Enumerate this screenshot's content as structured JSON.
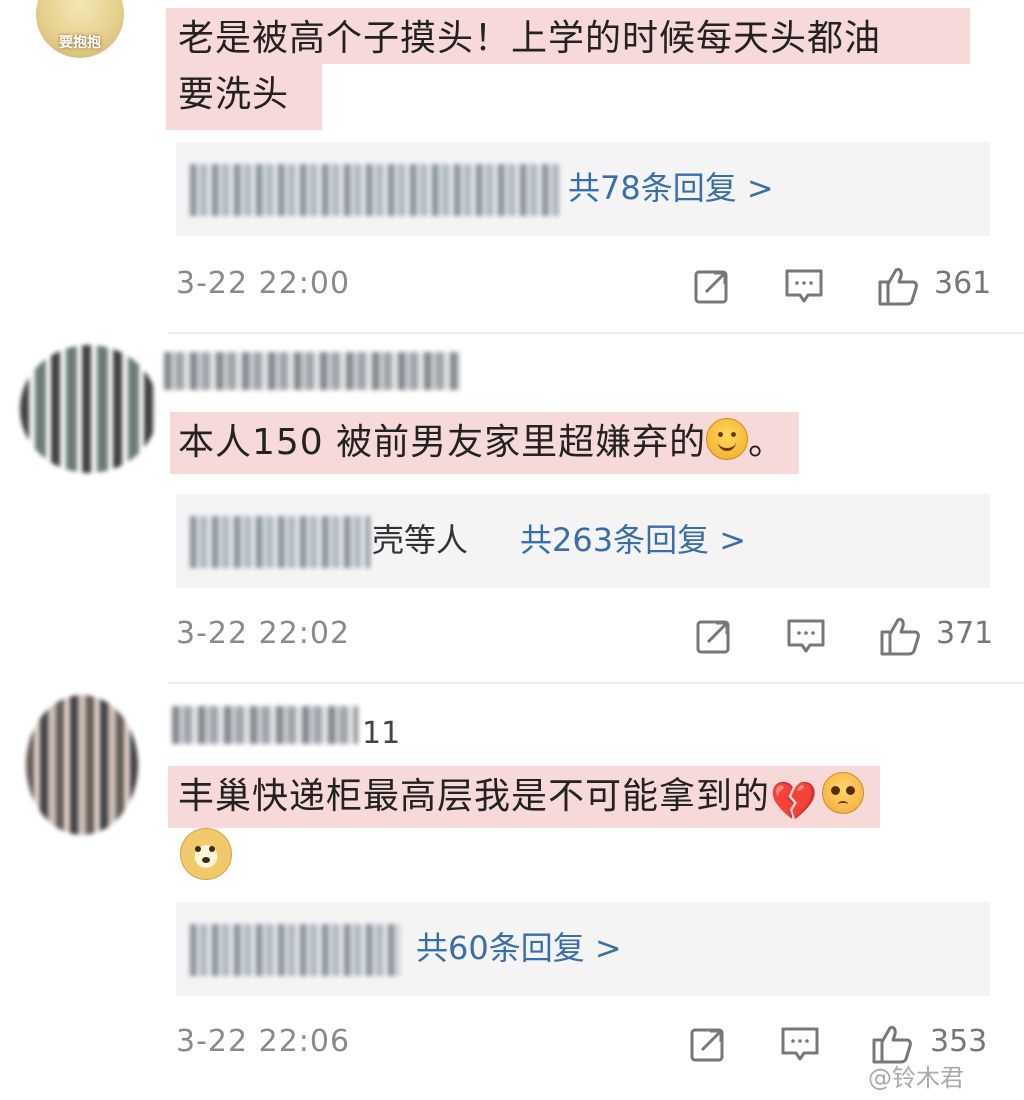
{
  "comments": [
    {
      "avatar_badge": "要抱抱",
      "username_suffix": "",
      "text": "老是被高个子摸头！上学的时候每天头都油要洗头",
      "text_line1": "老是被高个子摸头！上学的时候每天头都油",
      "text_line2": "要洗头",
      "replies_others": "",
      "replies_count": "共78条回复 >",
      "time": "3-22 22:00",
      "likes": "361"
    },
    {
      "avatar_badge": "",
      "username_suffix": "",
      "text": "本人150 被前男友家里超嫌弃的",
      "text_end": "。",
      "emoji": "slightly-smiling-face",
      "replies_others": "壳等人",
      "replies_count": "共263条回复 >",
      "time": "3-22 22:02",
      "likes": "371"
    },
    {
      "avatar_badge": "",
      "username_suffix": "11",
      "text": "丰巢快递柜最高层我是不可能拿到的",
      "emojis": [
        "broken-heart",
        "pleading-face",
        "doge"
      ],
      "replies_others": "",
      "replies_count": "共60条回复 >",
      "time": "3-22 22:06",
      "likes": "353"
    }
  ],
  "icons": {
    "share": "share-icon",
    "comment": "comment-icon",
    "like": "thumbs-up-icon"
  },
  "watermark": "@铃木君",
  "colors": {
    "highlight": "#f8d9d9",
    "link": "#3a6ea8",
    "meta": "#8a8a8a"
  }
}
